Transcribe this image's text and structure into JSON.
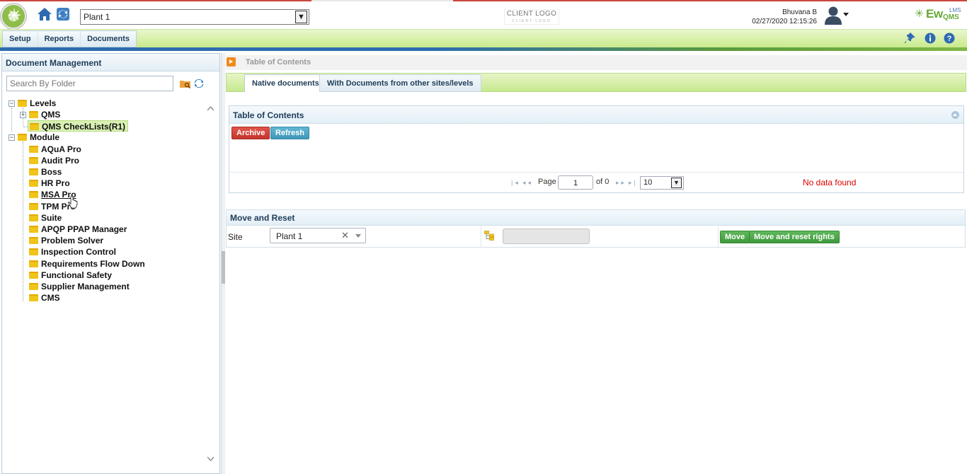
{
  "header": {
    "plant_select": "Plant 1",
    "client_logo": "CLIENT LOGO",
    "client_logo_sub": "CLIENT LOGO",
    "user_name": "Bhuvana B",
    "datetime": "02/27/2020 12:15:26",
    "brand_ew": "Ew",
    "brand_lms": "LMS",
    "brand_qms": "QMS"
  },
  "menu": {
    "items": [
      "Setup",
      "Reports",
      "Documents"
    ]
  },
  "left": {
    "title": "Document Management",
    "search_placeholder": "Search By Folder",
    "tree": {
      "levels": "Levels",
      "qms": "QMS",
      "qms_checklists": "QMS CheckLists(R1)",
      "module": "Module",
      "modules": [
        "AQuA Pro",
        "Audit Pro",
        "Boss",
        "HR Pro",
        "MSA Pro",
        "TPM Pro",
        "Suite",
        "APQP PPAP Manager",
        "Problem Solver",
        "Inspection Control",
        "Requirements Flow Down",
        "Functional Safety",
        "Supplier Management",
        "CMS"
      ]
    }
  },
  "main": {
    "breadcrumb": "Table of Contents",
    "tabs": [
      "Native documents",
      "With Documents from other sites/levels"
    ],
    "toc": {
      "title": "Table of Contents",
      "archive_label": "Archive",
      "refresh_label": "Refresh",
      "pager": {
        "page_label": "Page",
        "page_value": "1",
        "of_label": "of 0",
        "page_size": "10"
      },
      "no_data": "No data found"
    },
    "move": {
      "title": "Move and Reset",
      "site_label": "Site",
      "site_value": "Plant 1",
      "move_label": "Move",
      "move_reset_label": "Move and reset rights"
    }
  },
  "colors": {
    "accent_green": "#c7e98d",
    "danger": "#c4362e",
    "info": "#3f97b7",
    "success": "#3f9a3c"
  }
}
